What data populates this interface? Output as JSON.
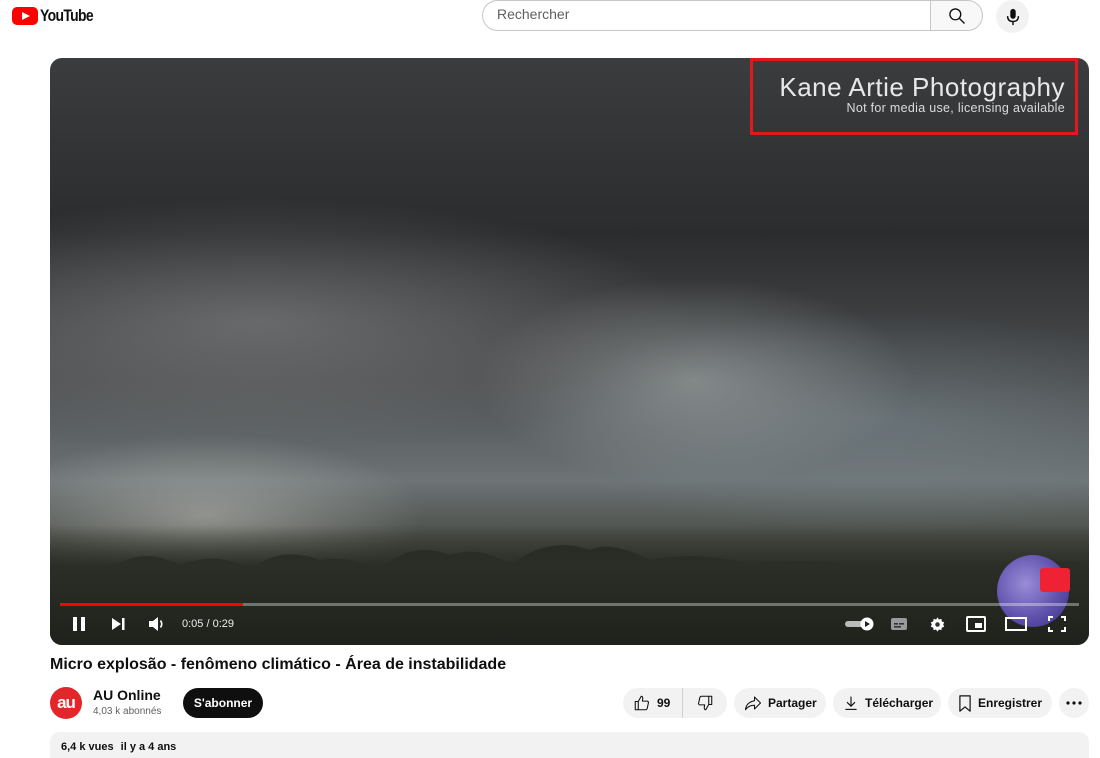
{
  "header": {
    "logo_text": "YouTube",
    "search_placeholder": "Rechercher",
    "search_icon": "search-icon",
    "mic_icon": "mic-icon"
  },
  "player": {
    "watermark_title": "Kane Artie Photography",
    "watermark_subtitle": "Not for media use, licensing available",
    "time": "0:05 / 0:29",
    "progress": 0.18,
    "accent": "#ff0000"
  },
  "video": {
    "title": "Micro explosão - fenômeno climático - Área de instabilidade"
  },
  "channel": {
    "avatar_text": "au",
    "name": "AU Online",
    "subscribers": "4,03 k abonnés",
    "subscribe_label": "S'abonner"
  },
  "actions": {
    "likes": "99",
    "share_label": "Partager",
    "download_label": "Télécharger",
    "save_label": "Enregistrer"
  },
  "description": {
    "views": "6,4 k vues",
    "date": "il y a 4 ans"
  }
}
